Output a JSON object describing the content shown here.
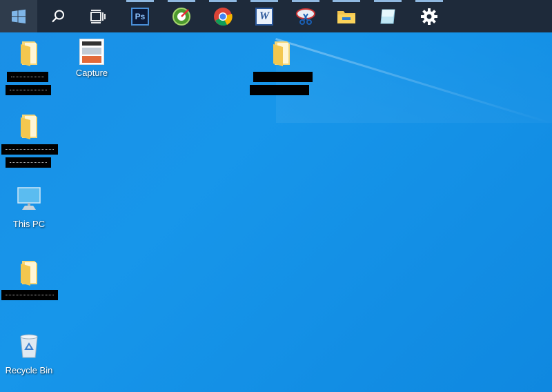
{
  "taskbar": {
    "buttons": [
      {
        "name": "start-button",
        "icon": "windows-logo-icon"
      },
      {
        "name": "search-button",
        "icon": "search-icon"
      },
      {
        "name": "task-view-button",
        "icon": "task-view-icon"
      },
      {
        "name": "photoshop-taskbar-button",
        "icon": "photoshop-icon",
        "label": "Ps"
      },
      {
        "name": "greenshot-taskbar-button",
        "icon": "greenshot-icon"
      },
      {
        "name": "chrome-taskbar-button",
        "icon": "chrome-icon"
      },
      {
        "name": "word-taskbar-button",
        "icon": "word-icon",
        "label": "W"
      },
      {
        "name": "snipping-tool-taskbar-button",
        "icon": "snipping-tool-icon"
      },
      {
        "name": "file-explorer-taskbar-button",
        "icon": "folder-icon"
      },
      {
        "name": "notes-taskbar-button",
        "icon": "notes-app-icon"
      },
      {
        "name": "settings-taskbar-button",
        "icon": "gear-icon"
      }
    ],
    "colors": {
      "background": "#1e2a3a",
      "active_indicator": "#8fb8e0"
    }
  },
  "desktop": {
    "icons": [
      {
        "label": "Capture",
        "icon": "image-thumbnail-icon"
      },
      {
        "label": "This PC",
        "icon": "monitor-icon"
      },
      {
        "label": "Recycle Bin",
        "icon": "recycle-bin-icon"
      }
    ],
    "redacted_folders": 4,
    "wallpaper_color": "#1a8fe6"
  }
}
